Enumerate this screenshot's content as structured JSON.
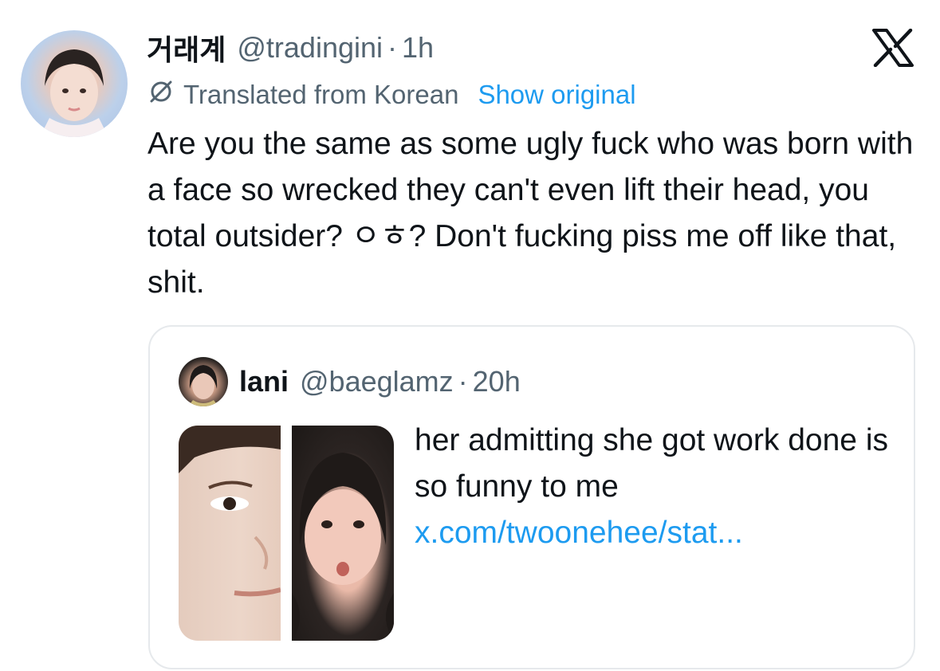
{
  "author": {
    "display_name": "거래계",
    "handle": "@tradingini",
    "separator": "·",
    "time": "1h"
  },
  "translation": {
    "label": "Translated from Korean",
    "show_original": "Show original",
    "icon": "globe-slash-icon"
  },
  "tweet": {
    "text": "Are you the same as some ugly fuck who was born with a face so wrecked they can't even lift their head, you total outsider? ㅇㅎ? Don't fucking piss me off like that, shit."
  },
  "quoted_tweet": {
    "display_name": "lani",
    "handle": "@baeglamz",
    "separator": "·",
    "time": "20h",
    "text": "her admitting she got work done is so funny to me",
    "link": "x.com/twoonehee/stat..."
  },
  "brand": {
    "logo": "x-logo-icon"
  },
  "colors": {
    "text": "#0f1419",
    "secondary": "#536471",
    "link": "#1d9bf0",
    "border": "#e6e9ec"
  }
}
